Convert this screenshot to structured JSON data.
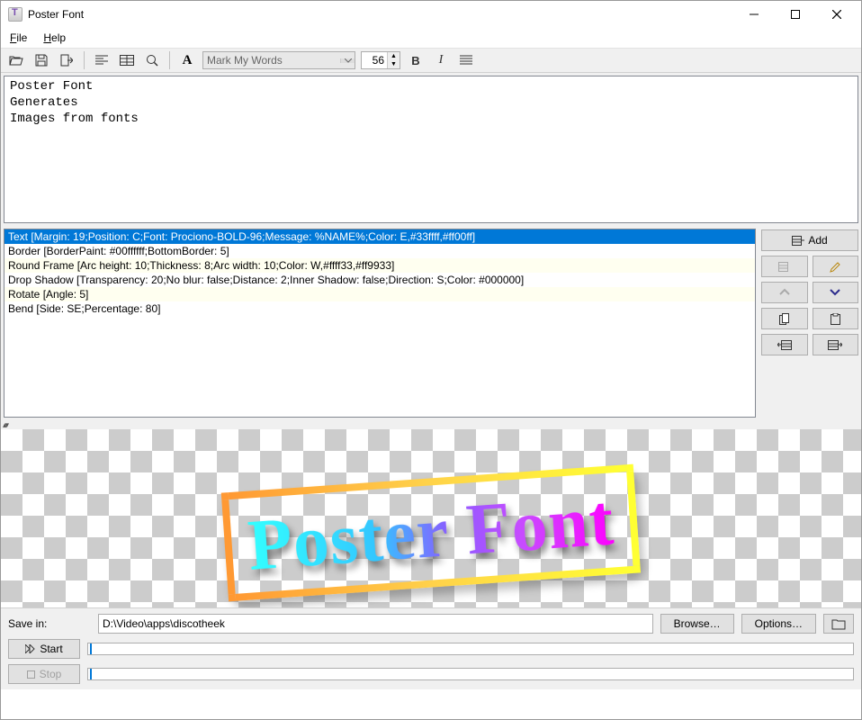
{
  "window": {
    "title": "Poster Font"
  },
  "menu": {
    "file": "File",
    "help": "Help"
  },
  "toolbar": {
    "font_name": "Mark My Words",
    "font_size": "56"
  },
  "editor_text": "Poster Font\nGenerates\nImages from fonts",
  "effects": [
    "Text [Margin: 19;Position: C;Font: Prociono-BOLD-96;Message: %NAME%;Color: E,#33ffff,#ff00ff]",
    "Border [BorderPaint: #00ffffff;BottomBorder: 5]",
    "Round Frame [Arc height: 10;Thickness: 8;Arc width: 10;Color: W,#ffff33,#ff9933]",
    "Drop Shadow [Transparency: 20;No blur: false;Distance: 2;Inner Shadow: false;Direction: S;Color: #000000]",
    "Rotate [Angle: 5]",
    "Bend [Side: SE;Percentage: 80]"
  ],
  "side": {
    "add": "Add"
  },
  "preview": {
    "text": "Poster Font"
  },
  "bottom": {
    "save_in_label": "Save in:",
    "path": "D:\\Video\\apps\\discotheek",
    "browse": "Browse…",
    "options": "Options…",
    "start": "Start",
    "stop": "Stop"
  }
}
